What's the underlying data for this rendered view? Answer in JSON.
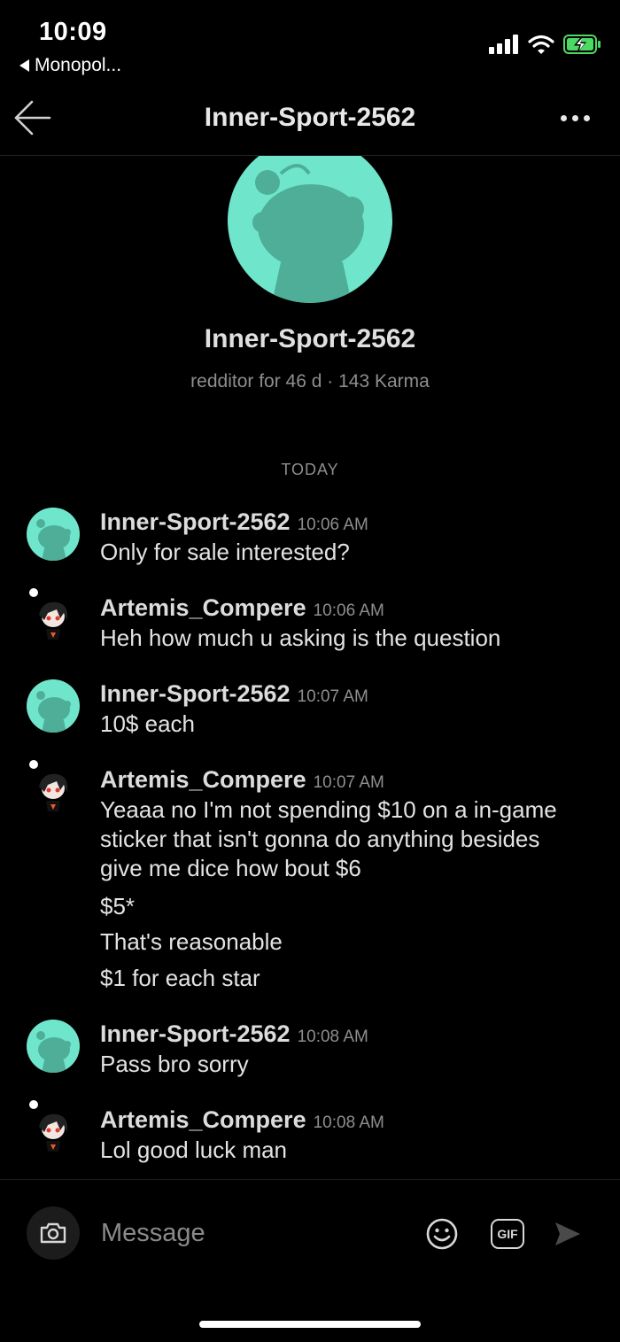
{
  "status_bar": {
    "time": "10:09",
    "back_app": "Monopol..."
  },
  "nav": {
    "title": "Inner-Sport-2562"
  },
  "profile": {
    "name": "Inner-Sport-2562",
    "meta": "redditor for 46 d · 143 Karma"
  },
  "day_divider": "TODAY",
  "messages": [
    {
      "user": "Inner-Sport-2562",
      "time": "10:06 AM",
      "lines": [
        "Only for sale interested?"
      ]
    },
    {
      "user": "Artemis_Compere",
      "time": "10:06 AM",
      "lines": [
        "Heh how much u asking is the question"
      ]
    },
    {
      "user": "Inner-Sport-2562",
      "time": "10:07 AM",
      "lines": [
        "10$ each"
      ]
    },
    {
      "user": "Artemis_Compere",
      "time": "10:07 AM",
      "lines": [
        "Yeaaa no I'm not spending $10 on a in-game sticker that isn't gonna do anything besides give me dice how bout $6",
        "$5*",
        "That's reasonable",
        "$1 for each star"
      ]
    },
    {
      "user": "Inner-Sport-2562",
      "time": "10:08 AM",
      "lines": [
        "Pass bro sorry"
      ]
    },
    {
      "user": "Artemis_Compere",
      "time": "10:08 AM",
      "lines": [
        "Lol good luck man"
      ]
    }
  ],
  "composer": {
    "placeholder": "Message",
    "gif_label": "GIF"
  },
  "colors": {
    "background": "#000000",
    "snoo_avatar": "#6fe6cc",
    "snoo_shape": "#4fae98",
    "battery_charging": "#4cd964"
  },
  "icons": [
    "back-arrow-icon",
    "more-icon",
    "camera-icon",
    "emoji-icon",
    "gif-icon",
    "send-icon",
    "signal-icon",
    "wifi-icon",
    "battery-icon"
  ]
}
